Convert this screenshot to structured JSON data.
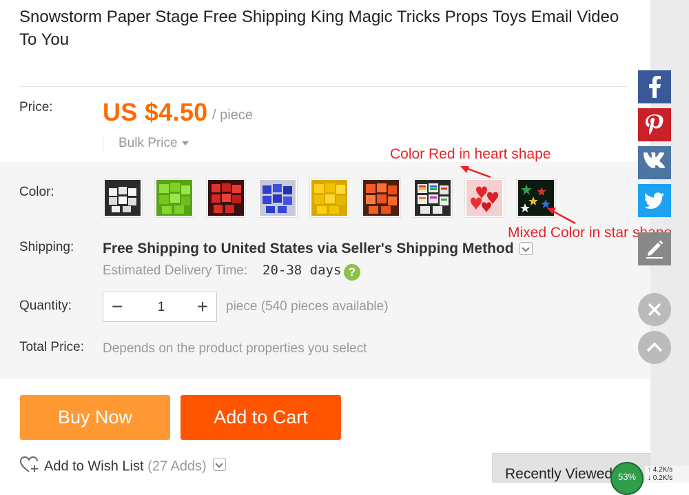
{
  "product": {
    "title": "Snowstorm Paper Stage Free Shipping King Magic Tricks Props Toys Email Video To You"
  },
  "price": {
    "label": "Price:",
    "amount": "US $4.50",
    "unit": "/ piece",
    "bulk_label": "Bulk Price"
  },
  "color": {
    "label": "Color:",
    "options": [
      {
        "name": "white-cubes",
        "color": "#e8e8e8"
      },
      {
        "name": "green-cubes",
        "color": "#7ed321"
      },
      {
        "name": "red-cubes",
        "color": "#d0271d"
      },
      {
        "name": "blue-cubes",
        "color": "#2e3fcc"
      },
      {
        "name": "yellow-cubes",
        "color": "#f2c200"
      },
      {
        "name": "orange-cubes",
        "color": "#f05a22"
      },
      {
        "name": "rainbow-cubes",
        "color": "#cc3333"
      },
      {
        "name": "red-hearts",
        "color": "#e3262a"
      },
      {
        "name": "mixed-stars",
        "color": "#1d6b3a"
      }
    ],
    "annotation_heart": "Color Red in heart shape",
    "annotation_star": "Mixed Color in star shape"
  },
  "shipping": {
    "label": "Shipping:",
    "method": "Free Shipping to United States via Seller's Shipping Method",
    "est_label": "Estimated Delivery Time:",
    "est_days": "20-38 days",
    "help": "?"
  },
  "quantity": {
    "label": "Quantity:",
    "minus": "−",
    "value": "1",
    "plus": "+",
    "note": "piece (540 pieces available)"
  },
  "total": {
    "label": "Total Price:",
    "note": "Depends on the product properties you select"
  },
  "buttons": {
    "buy_now": "Buy Now",
    "add_to_cart": "Add to Cart"
  },
  "wishlist": {
    "label": "Add to Wish List",
    "count": "(27 Adds)"
  },
  "social": {
    "facebook": "f",
    "pinterest": "P",
    "vk": "VK"
  },
  "recently_viewed": {
    "label": "Recently Viewed"
  },
  "network_widget": {
    "percent": "53%",
    "up_speed": "4.2K/s",
    "down_speed": "0.2K/s"
  },
  "colors": {
    "accent_orange": "#ff6a00",
    "buy_now_bg": "#ff9933",
    "add_to_cart_bg": "#ff5500",
    "annotation_red": "#e8232a",
    "facebook": "#3b5998",
    "pinterest": "#cb2027",
    "vk": "#4c75a3",
    "twitter": "#1da1f2"
  }
}
